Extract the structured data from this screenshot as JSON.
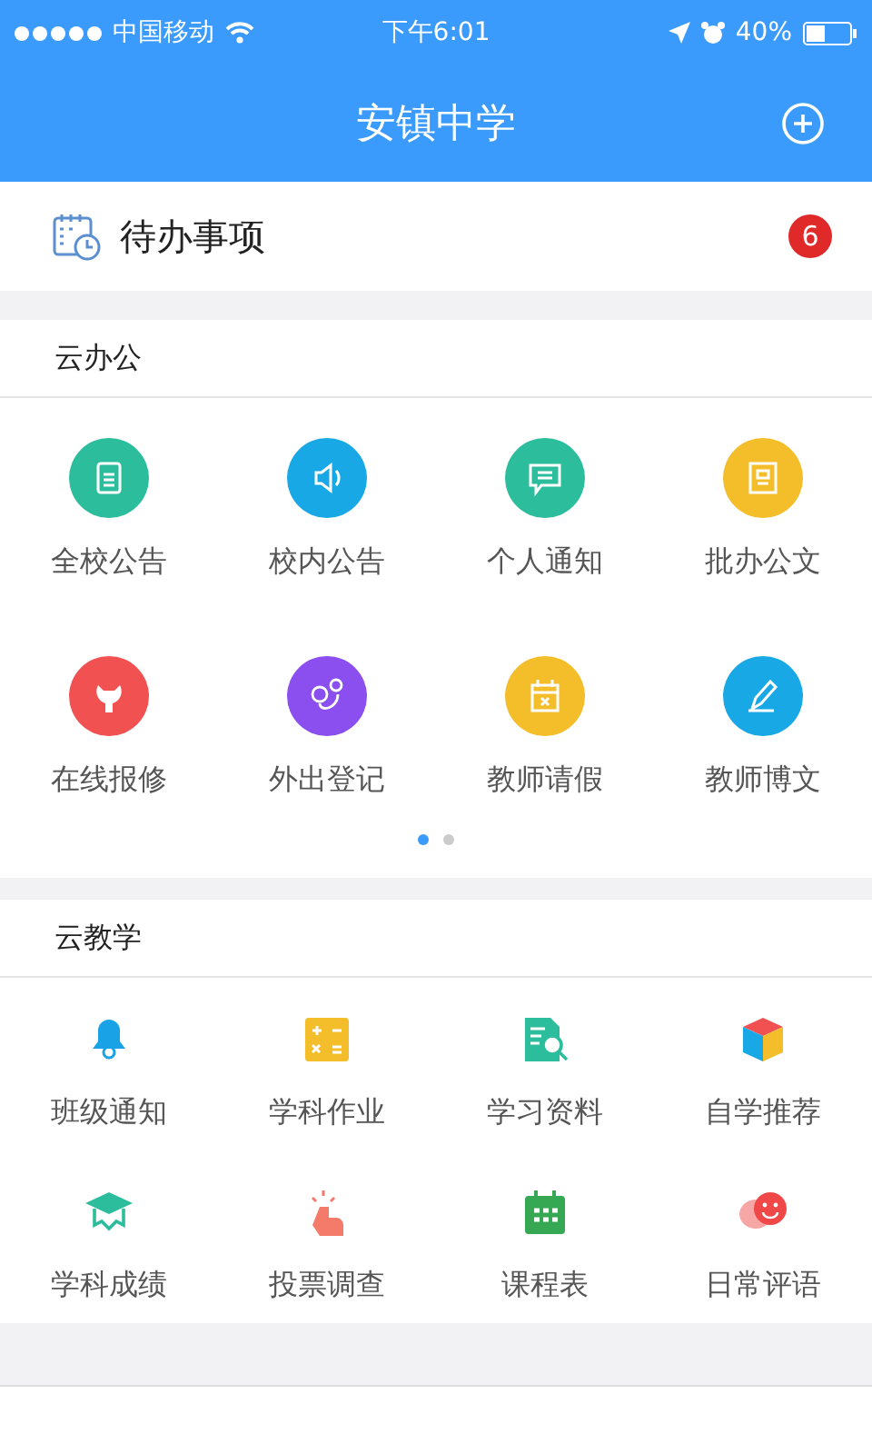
{
  "status_bar": {
    "carrier": "中国移动",
    "time": "下午6:01",
    "battery": "40%"
  },
  "header": {
    "title": "安镇中学"
  },
  "todo": {
    "label": "待办事项",
    "badge": "6"
  },
  "sections": [
    {
      "title": "云办公",
      "kind": "circle",
      "items": [
        {
          "label": "全校公告"
        },
        {
          "label": "校内公告"
        },
        {
          "label": "个人通知"
        },
        {
          "label": "批办公文"
        },
        {
          "label": "在线报修"
        },
        {
          "label": "外出登记"
        },
        {
          "label": "教师请假"
        },
        {
          "label": "教师博文"
        }
      ],
      "pages": [
        {
          "selected": true
        },
        {
          "selected": false
        }
      ]
    },
    {
      "title": "云教学",
      "kind": "plain",
      "items": [
        {
          "label": "班级通知"
        },
        {
          "label": "学科作业"
        },
        {
          "label": "学习资料"
        },
        {
          "label": "自学推荐"
        },
        {
          "label": "学科成绩"
        },
        {
          "label": "投票调查"
        },
        {
          "label": "课程表"
        },
        {
          "label": "日常评语"
        }
      ]
    }
  ]
}
